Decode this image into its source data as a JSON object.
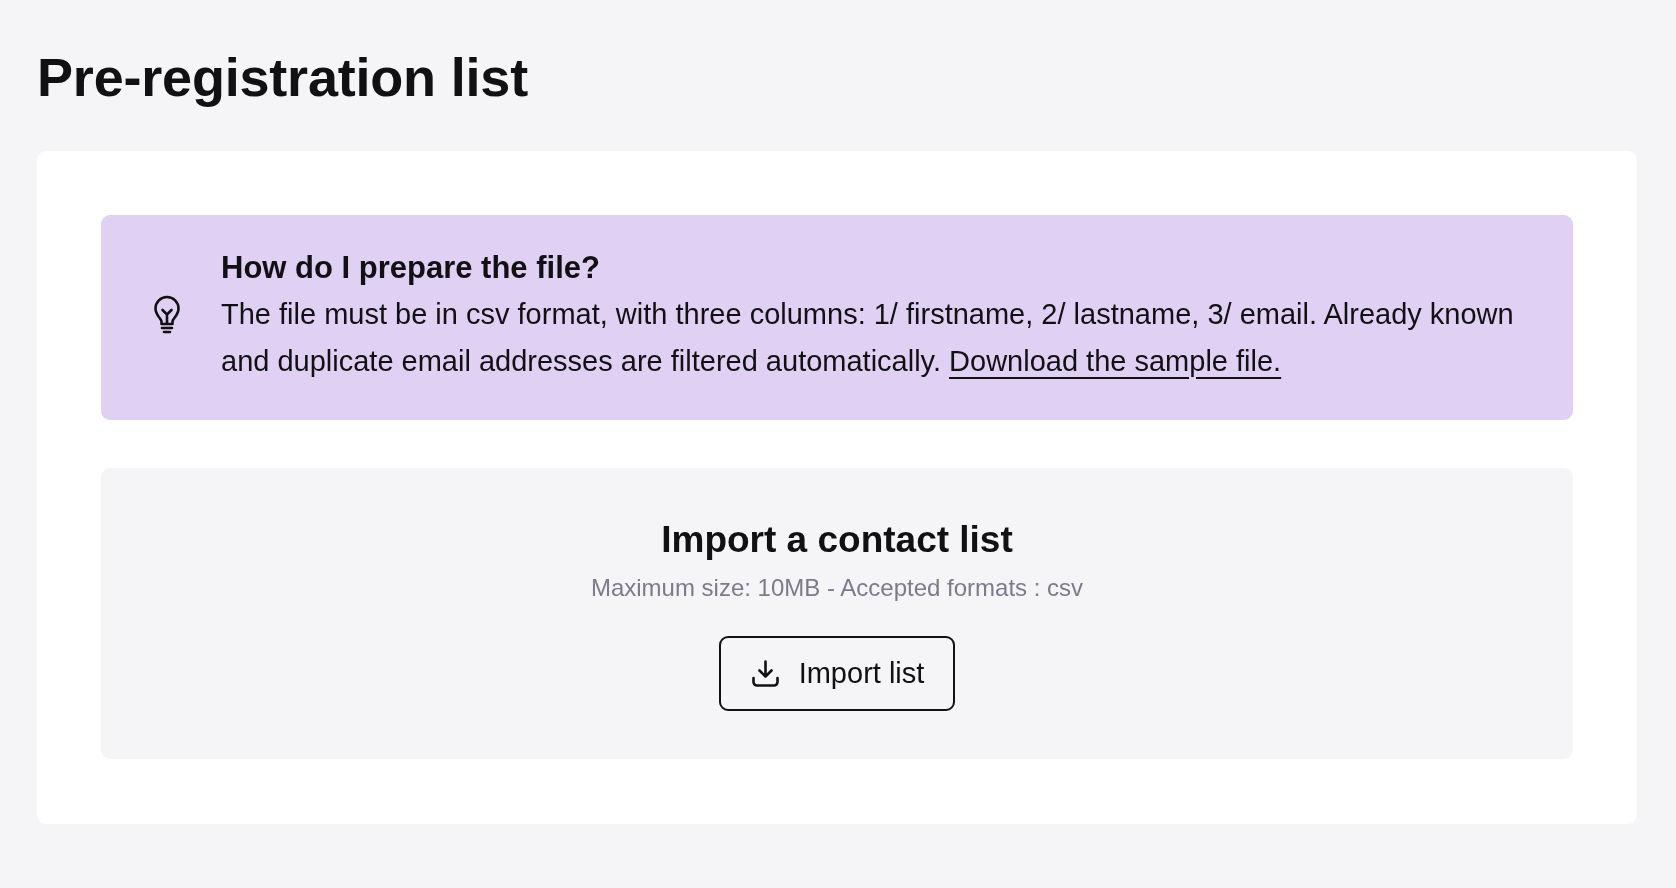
{
  "page": {
    "title": "Pre-registration list"
  },
  "info": {
    "title": "How do I prepare the file?",
    "text": "The file must be in csv format, with three columns: 1/ firstname, 2/ lastname, 3/ email. Already known and duplicate email addresses are filtered automatically.",
    "link": "Download the sample file."
  },
  "import": {
    "title": "Import a contact list",
    "hint": "Maximum size: 10MB - Accepted formats : csv",
    "button": "Import list"
  }
}
